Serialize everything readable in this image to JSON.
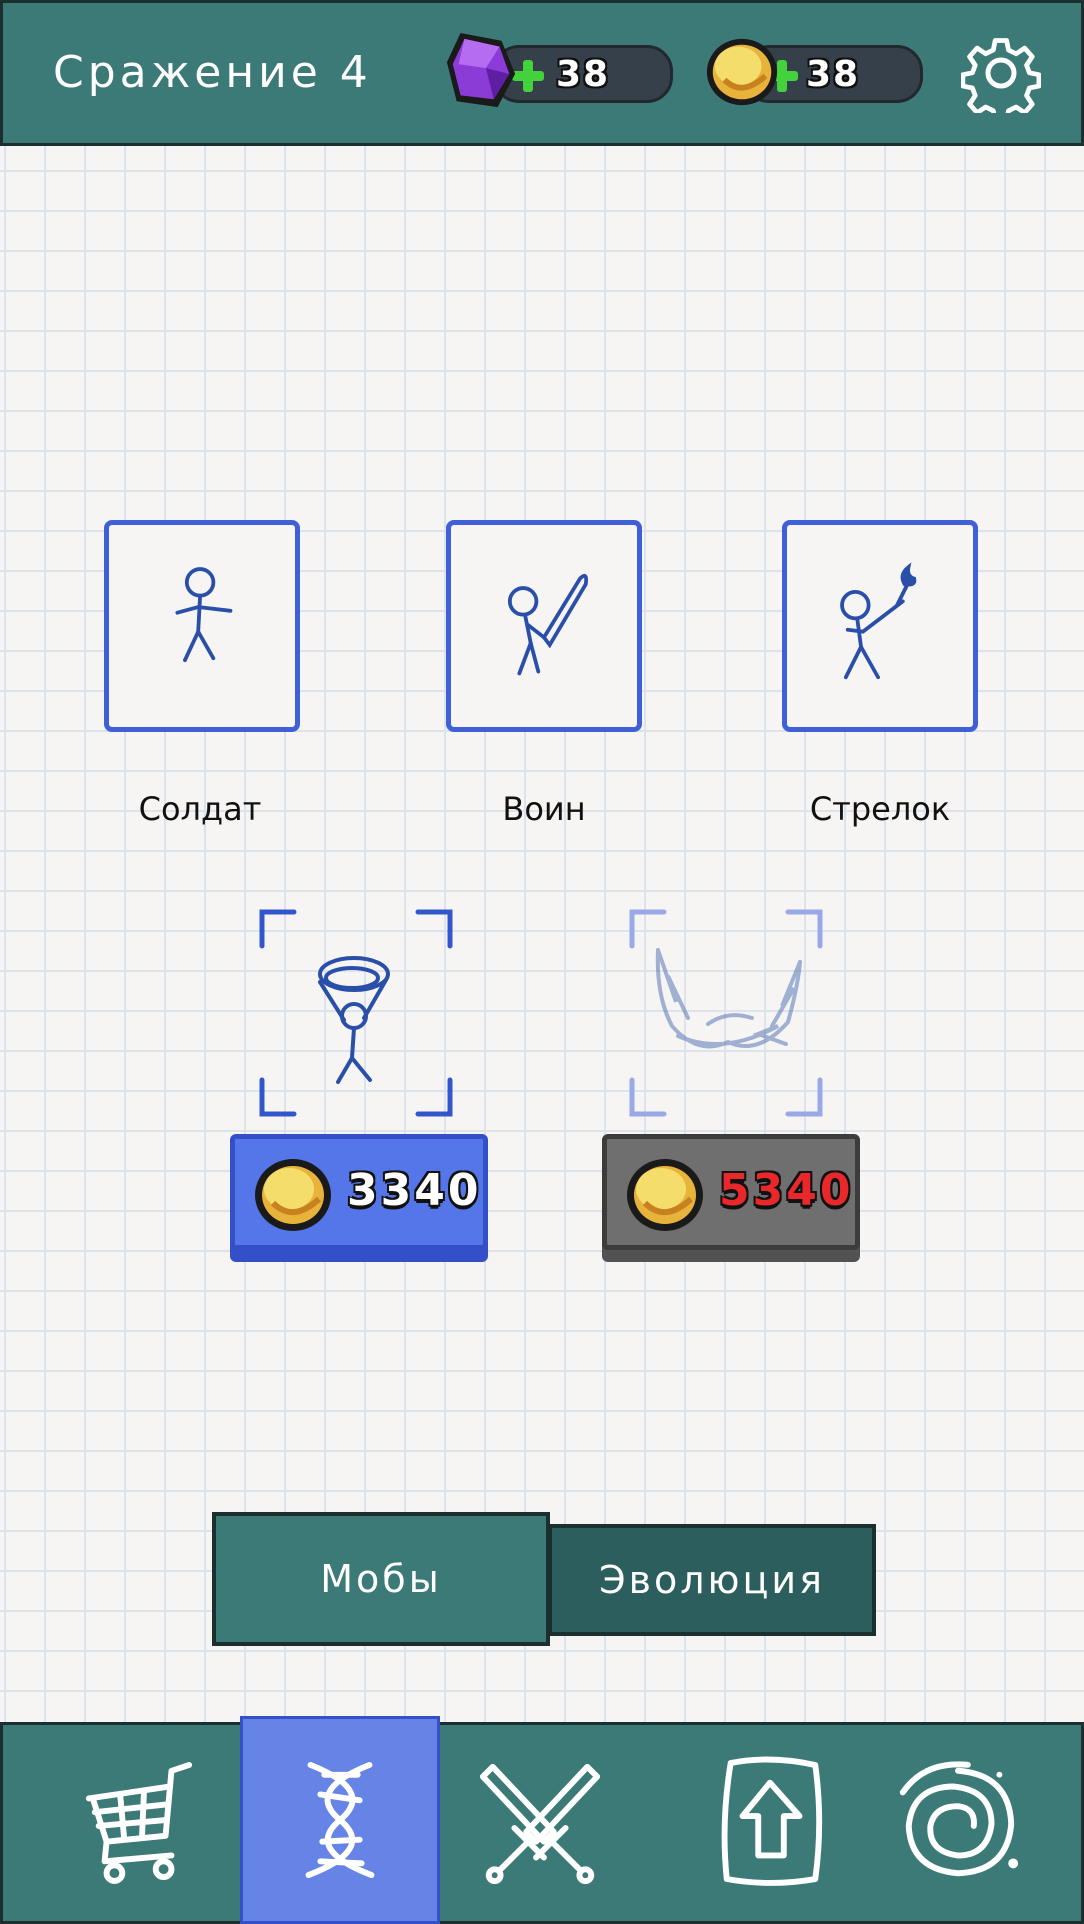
{
  "header": {
    "title": "Сражение 4",
    "gems": {
      "amount": "38",
      "icon": "purple-gem-icon",
      "add_icon": "plus-icon"
    },
    "coins": {
      "amount": "38",
      "icon": "gold-coin-icon",
      "add_icon": "plus-icon"
    },
    "settings_icon": "gear-icon"
  },
  "units": [
    {
      "label": "Солдат",
      "icon": "stickman-soldier-icon"
    },
    {
      "label": "Воин",
      "icon": "stickman-warrior-sword-icon"
    },
    {
      "label": "Стрелок",
      "icon": "stickman-archer-torch-icon"
    }
  ],
  "upgrades": [
    {
      "icon": "stickman-rope-icon",
      "price": "3340",
      "affordable": true
    },
    {
      "icon": "dragon-sketch-icon",
      "price": "5340",
      "affordable": false
    }
  ],
  "tabs": {
    "mobs": "Мобы",
    "evolution": "Эволюция"
  },
  "bottom_nav": [
    {
      "icon": "shop-cart-icon",
      "active": false
    },
    {
      "icon": "dna-evolution-icon",
      "active": true
    },
    {
      "icon": "crossed-swords-icon",
      "active": false
    },
    {
      "icon": "upgrade-arrow-icon",
      "active": false
    },
    {
      "icon": "portal-spiral-icon",
      "active": false
    }
  ],
  "colors": {
    "bar": "#3b7a77",
    "accent_blue": "#5576e8",
    "disabled_gray": "#6f6f70",
    "price_red": "#e8282a",
    "unit_stroke": "#2a4fa8"
  }
}
